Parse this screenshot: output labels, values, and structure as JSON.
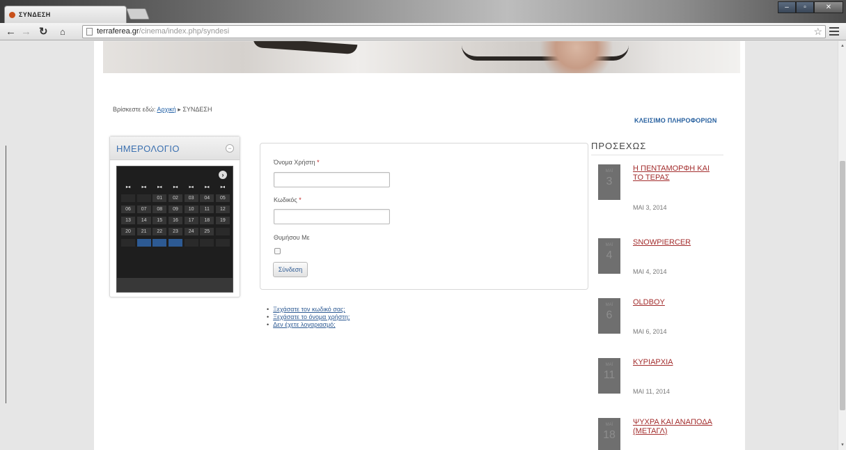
{
  "browser": {
    "tab_title": "ΣΥΝΔΕΣΗ",
    "url_host": "terraferea.gr",
    "url_path": "/cinema/index.php/syndesi"
  },
  "breadcrumb": {
    "prefix": "Βρίσκεστε εδώ:",
    "home": "Αρχική",
    "separator": "▸",
    "current": "ΣΥΝΔΕΣΗ"
  },
  "close_info": "ΚΛΕΙΣΙΜΟ ΠΛΗΡΟΦΟΡΙΩΝ",
  "calendar": {
    "title": "ΗΜΕΡΟΛΟΓΙΟ",
    "toggle": "−",
    "next": "›"
  },
  "login": {
    "username_label": "Όνομα Χρήστη",
    "password_label": "Κωδικός",
    "required_mark": "*",
    "remember_label": "Θυμήσου Με",
    "submit": "Σύνδεση"
  },
  "links": [
    "Ξεχάσατε τον κωδικό σας;",
    "Ξεχάσατε το όνομα χρήστη;",
    "Δεν έχετε λογαριασμό;"
  ],
  "upcoming": {
    "title": "ΠΡΟΣΕΧΩΣ",
    "events": [
      {
        "month": "ΜΑΪ",
        "day": "3",
        "title": "Η ΠΕΝΤΑΜΟΡΦΗ ΚΑΙ ΤΟ ΤΕΡΑΣ",
        "date": "ΜΑΙ 3, 2014"
      },
      {
        "month": "ΜΑΪ",
        "day": "4",
        "title": "SNOWPIERCER",
        "date": "ΜΑΙ 4, 2014"
      },
      {
        "month": "ΜΑΪ",
        "day": "6",
        "title": "OLDBOY",
        "date": "ΜΑΙ 6, 2014"
      },
      {
        "month": "ΜΑΪ",
        "day": "11",
        "title": "ΚΥΡΙΑΡΧΙΑ",
        "date": "ΜΑΙ 11, 2014"
      },
      {
        "month": "ΜΑΪ",
        "day": "18",
        "title": "ΨΥΧΡΑ ΚΑΙ ΑΝΑΠΟΔΑ (ΜΕΤΑΓΛ)",
        "date": ""
      }
    ]
  }
}
